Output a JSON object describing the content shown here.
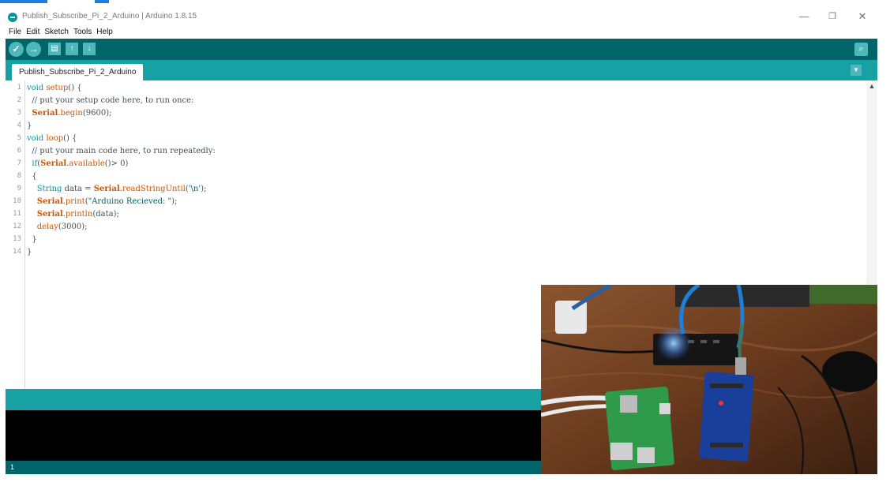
{
  "window": {
    "title": "Publish_Subscribe_Pi_2_Arduino | Arduino 1.8.15",
    "minimize_glyph": "—",
    "maximize_glyph": "❐",
    "close_glyph": "✕"
  },
  "menu": {
    "items": [
      "File",
      "Edit",
      "Sketch",
      "Tools",
      "Help"
    ]
  },
  "toolbar": {
    "verify_glyph": "✓",
    "upload_glyph": "→",
    "new_glyph": "▤",
    "open_glyph": "↑",
    "save_glyph": "↓",
    "serial_monitor_glyph": "⌕"
  },
  "tabs": {
    "active": "Publish_Subscribe_Pi_2_Arduino",
    "menu_glyph": "▼"
  },
  "editor": {
    "line_numbers": [
      "1",
      "2",
      "3",
      "4",
      "5",
      "6",
      "7",
      "8",
      "9",
      "10",
      "11",
      "12",
      "13",
      "14"
    ],
    "lines": [
      "void setup() {",
      "  // put your setup code here, to run once:",
      "  Serial.begin(9600);",
      "}",
      "void loop() {",
      "  // put your main code here, to run repeatedly:",
      "  if(Serial.available()> 0)",
      "  {",
      "    String data = Serial.readStringUntil('\\n');",
      "    Serial.print(\"Arduino Recieved: \");",
      "    Serial.println(data);",
      "    delay(3000);",
      "  }",
      "}"
    ],
    "scroll_up_glyph": "▲"
  },
  "status": {
    "line": "1"
  },
  "colors": {
    "toolbar": "#006468",
    "tabbar": "#17a1a5",
    "button": "#4db7bb",
    "keyword": "#00979c",
    "function": "#d35400"
  },
  "webcam": {
    "description_icon": "camera-feed-icon"
  }
}
